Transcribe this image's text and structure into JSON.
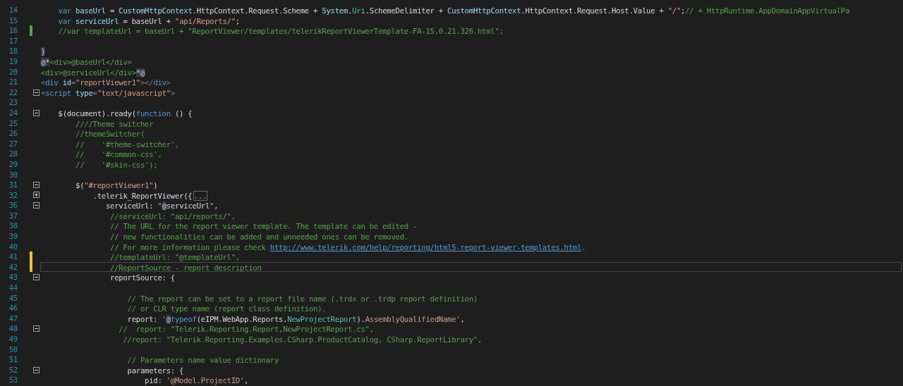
{
  "editor": {
    "lines": [
      {
        "number": "14",
        "current": false,
        "tokens": [
          {
            "kind": "kw",
            "text": "    var"
          },
          {
            "kind": "var",
            "text": " baseUrl"
          },
          {
            "kind": "plain",
            "text": " = "
          },
          {
            "kind": "var",
            "text": "CustomHttpContext"
          },
          {
            "kind": "plain",
            "text": ".HttpContext.Request.Scheme + "
          },
          {
            "kind": "var",
            "text": "System"
          },
          {
            "kind": "plain",
            "text": "."
          },
          {
            "kind": "type",
            "text": "Uri"
          },
          {
            "kind": "plain",
            "text": ".SchemeDelimiter + "
          },
          {
            "kind": "var",
            "text": "CustomHttpContext"
          },
          {
            "kind": "plain",
            "text": ".HttpContext.Request.Host.Value + "
          },
          {
            "kind": "str",
            "text": "\"/\""
          },
          {
            "kind": "plain",
            "text": ";"
          },
          {
            "kind": "com",
            "text": "// + HttpRuntime.AppDomainAppVirtualPa"
          }
        ]
      },
      {
        "number": "15",
        "current": false,
        "tokens": [
          {
            "kind": "kw",
            "text": "    var"
          },
          {
            "kind": "var",
            "text": " serviceUrl"
          },
          {
            "kind": "plain",
            "text": " = baseUrl + "
          },
          {
            "kind": "str",
            "text": "\"api/Reports/\""
          },
          {
            "kind": "plain",
            "text": ";"
          }
        ]
      },
      {
        "number": "16",
        "marker": {
          "saved": true
        },
        "current": false,
        "tokens": [
          {
            "kind": "com",
            "text": "    //var templateUrl = baseUrl + \"ReportViewer/templates/telerikReportViewerTemplate-FA-15.0.21.326.html\";"
          }
        ]
      },
      {
        "number": "17",
        "current": false
      },
      {
        "number": "18",
        "current": false,
        "tokens": [
          {
            "kind": "razor",
            "text": "}"
          }
        ]
      },
      {
        "number": "19",
        "current": false,
        "tokens": [
          {
            "kind": "razor",
            "text": "@*"
          },
          {
            "kind": "com",
            "text": "<div>@baseUrl</div>"
          }
        ]
      },
      {
        "number": "20",
        "current": false,
        "tokens": [
          {
            "kind": "com",
            "text": "<div>@serviceUrl</div>"
          },
          {
            "kind": "razor",
            "text": "*@"
          }
        ]
      },
      {
        "number": "21",
        "current": false,
        "tokens": [
          {
            "kind": "punct",
            "text": "<"
          },
          {
            "kind": "tag",
            "text": "div"
          },
          {
            "kind": "attr",
            "text": " id"
          },
          {
            "kind": "punct",
            "text": "="
          },
          {
            "kind": "str",
            "text": "\"reportViewer1\""
          },
          {
            "kind": "punct",
            "text": "></"
          },
          {
            "kind": "tag",
            "text": "div"
          },
          {
            "kind": "punct",
            "text": ">"
          }
        ]
      },
      {
        "number": "22",
        "folded": false,
        "current": false,
        "tokens": [
          {
            "kind": "punct",
            "text": "<"
          },
          {
            "kind": "tag",
            "text": "script"
          },
          {
            "kind": "attr",
            "text": " type"
          },
          {
            "kind": "punct",
            "text": "="
          },
          {
            "kind": "str",
            "text": "\"text/javascript\""
          },
          {
            "kind": "punct",
            "text": ">"
          }
        ]
      },
      {
        "number": "23",
        "current": false
      },
      {
        "number": "24",
        "folded": false,
        "current": false,
        "tokens": [
          {
            "kind": "plain",
            "text": "    $(document).ready("
          },
          {
            "kind": "kw",
            "text": "function"
          },
          {
            "kind": "plain",
            "text": " () {"
          }
        ]
      },
      {
        "number": "25",
        "current": false,
        "tokens": [
          {
            "kind": "com",
            "text": "        ////Theme switcher"
          }
        ]
      },
      {
        "number": "26",
        "current": false,
        "tokens": [
          {
            "kind": "com",
            "text": "        //themeSwitcher("
          }
        ]
      },
      {
        "number": "27",
        "current": false,
        "tokens": [
          {
            "kind": "com",
            "text": "        //    '#theme-switcher',"
          }
        ]
      },
      {
        "number": "28",
        "current": false,
        "tokens": [
          {
            "kind": "com",
            "text": "        //    '#common-css',"
          }
        ]
      },
      {
        "number": "29",
        "current": false,
        "tokens": [
          {
            "kind": "com",
            "text": "        //    '#skin-css');"
          }
        ]
      },
      {
        "number": "30",
        "current": false
      },
      {
        "number": "31",
        "folded": false,
        "current": false,
        "tokens": [
          {
            "kind": "plain",
            "text": "        $("
          },
          {
            "kind": "str",
            "text": "\"#reportViewer1\""
          },
          {
            "kind": "plain",
            "text": ")"
          }
        ]
      },
      {
        "number": "32",
        "folded": true,
        "current": false,
        "tokens": [
          {
            "kind": "plain",
            "text": "            .telerik_ReportViewer({"
          },
          {
            "kind": "folded",
            "text": "..."
          }
        ]
      },
      {
        "number": "36",
        "folded": false,
        "current": false,
        "tokens": [
          {
            "kind": "plain",
            "text": "               serviceUrl: "
          },
          {
            "kind": "str",
            "text": "\""
          },
          {
            "kind": "razor",
            "text": "@"
          },
          {
            "kind": "plain",
            "text": "serviceUrl"
          },
          {
            "kind": "str",
            "text": "\""
          },
          {
            "kind": "plain",
            "text": ","
          }
        ]
      },
      {
        "number": "37",
        "current": false,
        "tokens": [
          {
            "kind": "com",
            "text": "                //serviceUrl: \"api/reports/\","
          }
        ]
      },
      {
        "number": "38",
        "current": false,
        "tokens": [
          {
            "kind": "com",
            "text": "                // The URL for the report viewer template. The template can be edited -"
          }
        ]
      },
      {
        "number": "39",
        "current": false,
        "tokens": [
          {
            "kind": "com",
            "text": "                // new functionalities can be added and unneeded ones can be removed."
          }
        ]
      },
      {
        "number": "40",
        "current": false,
        "tokens": [
          {
            "kind": "com",
            "text": "                // For more information please check "
          },
          {
            "kind": "link",
            "text": "http://www.telerik.com/help/reporting/html5-report-viewer-templates.html"
          },
          {
            "kind": "com",
            "text": "."
          }
        ]
      },
      {
        "number": "41",
        "marker": {
          "saved": false
        },
        "current": false,
        "tokens": [
          {
            "kind": "com",
            "text": "                //templateUrl: \"@templateUrl\","
          }
        ]
      },
      {
        "number": "42",
        "marker": {
          "saved": false
        },
        "current": true,
        "tokens": [
          {
            "kind": "com",
            "text": "                //ReportSource - report description"
          }
        ]
      },
      {
        "number": "43",
        "folded": false,
        "current": false,
        "tokens": [
          {
            "kind": "plain",
            "text": "                reportSource: {"
          }
        ]
      },
      {
        "number": "44",
        "current": false
      },
      {
        "number": "45",
        "current": false,
        "tokens": [
          {
            "kind": "com",
            "text": "                    // The report can be set to a report file name (.trdx or .trdp report definition)"
          }
        ]
      },
      {
        "number": "46",
        "current": false,
        "tokens": [
          {
            "kind": "com",
            "text": "                    // or CLR type name (report class definition)."
          }
        ]
      },
      {
        "number": "47",
        "current": false,
        "tokens": [
          {
            "kind": "plain",
            "text": "                    report: "
          },
          {
            "kind": "str",
            "text": "'"
          },
          {
            "kind": "razor",
            "text": "@"
          },
          {
            "kind": "kw",
            "text": "typeof"
          },
          {
            "kind": "plain",
            "text": "(eIPM.WebApp.Reports."
          },
          {
            "kind": "type",
            "text": "NewProjectReport"
          },
          {
            "kind": "plain",
            "text": ")."
          },
          {
            "kind": "str",
            "text": "AssemblyQualifiedName'"
          },
          {
            "kind": "plain",
            "text": ","
          }
        ]
      },
      {
        "number": "48",
        "folded": false,
        "current": false,
        "tokens": [
          {
            "kind": "com",
            "text": "                  //  report: \"Telerik.Reporting.Report,NewProjectReport.cs\","
          }
        ]
      },
      {
        "number": "49",
        "current": false,
        "tokens": [
          {
            "kind": "com",
            "text": "                   //report: \"Telerik.Reporting.Examples.CSharp.ProductCatalog, CSharp.ReportLibrary\","
          }
        ]
      },
      {
        "number": "50",
        "current": false
      },
      {
        "number": "51",
        "current": false,
        "tokens": [
          {
            "kind": "com",
            "text": "                    // Parameters name value dictionary"
          }
        ]
      },
      {
        "number": "52",
        "folded": false,
        "current": false,
        "tokens": [
          {
            "kind": "plain",
            "text": "                    parameters: {"
          }
        ]
      },
      {
        "number": "53",
        "current": false,
        "tokens": [
          {
            "kind": "plain",
            "text": "                        pid: "
          },
          {
            "kind": "str",
            "text": "'@Model.ProjectID'"
          },
          {
            "kind": "plain",
            "text": ","
          }
        ]
      }
    ]
  }
}
